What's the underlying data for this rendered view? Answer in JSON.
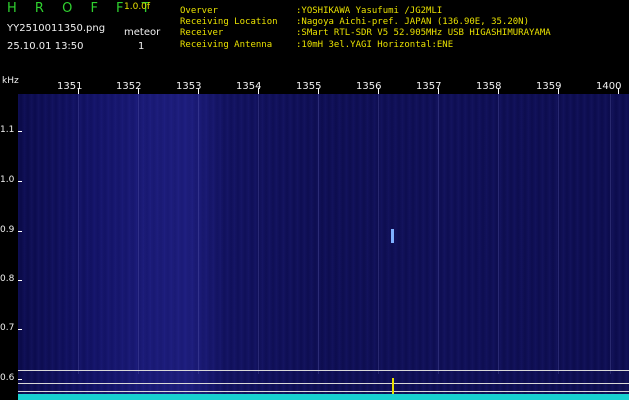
{
  "header": {
    "app_title": "H R O F F T",
    "version": "1.0.0f",
    "filename": "YY2510011350.png",
    "datetime": "25.10.01 13:50",
    "mode_label": "meteor",
    "mode_count": "1",
    "info": [
      {
        "key": "Overver",
        "value": ":YOSHIKAWA Yasufumi /JG2MLI"
      },
      {
        "key": "Receiving Location",
        "value": ":Nagoya Aichi-pref. JAPAN (136.90E, 35.20N)"
      },
      {
        "key": "Receiver",
        "value": ":SMart RTL-SDR V5 52.905MHz USB HIGASHIMURAYAMA"
      },
      {
        "key": "Receiving Antenna",
        "value": ":10mH 3el.YAGI Horizontal:ENE"
      }
    ]
  },
  "axis": {
    "unit": "kHz",
    "time_ticks": [
      "1351",
      "1352",
      "1353",
      "1354",
      "1355",
      "1356",
      "1357",
      "1358",
      "1359",
      "1400"
    ],
    "freq_ticks": [
      "1.1",
      "1.0",
      "0.9",
      "0.8",
      "0.7",
      "0.6"
    ]
  },
  "colors": {
    "title_green": "#2fd12f",
    "version_yellow": "#e8e000",
    "waterfall_blue": "#12126a",
    "spectrum_cyan": "#17d0d0"
  }
}
